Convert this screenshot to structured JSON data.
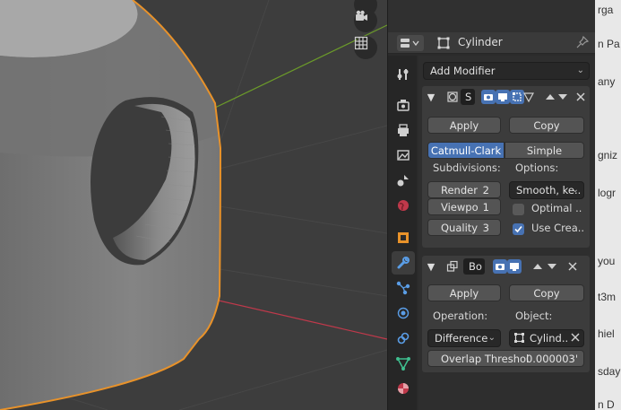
{
  "header": {
    "object_name": "Cylinder"
  },
  "content": {
    "add_modifier_label": "Add Modifier"
  },
  "subsurf": {
    "name": "S",
    "apply_label": "Apply",
    "copy_label": "Copy",
    "algorithm": {
      "catmull_label": "Catmull-Clark",
      "simple_label": "Simple",
      "selected": "Catmull-Clark"
    },
    "subdivisions_label": "Subdivisions:",
    "options_label": "Options:",
    "render_label": "Render",
    "render_value": "2",
    "viewport_label": "Viewpo",
    "viewport_value": "1",
    "quality_label": "Quality",
    "quality_value": "3",
    "uv_smooth_value": "Smooth, ke..",
    "optimal_label": "Optimal ..",
    "optimal_checked": false,
    "use_crease_label": "Use Crea..",
    "use_crease_checked": true
  },
  "boolean": {
    "name": "Bo",
    "apply_label": "Apply",
    "copy_label": "Copy",
    "operation_label": "Operation:",
    "object_label": "Object:",
    "operation_value": "Difference",
    "object_value": "Cylind..",
    "overlap_label": "Overlap Threshol",
    "overlap_value": "0.000003'"
  },
  "background_text": [
    "rga",
    "n Pa",
    "any",
    "gniz",
    "logr",
    "you",
    "t3m",
    "hiel",
    "sday",
    "n D"
  ],
  "colors": {
    "accent_blue": "#4772b3",
    "selection_orange": "#e8922a",
    "axis_red": "#c0394b",
    "axis_green": "#6b9a2a",
    "panel_bg": "#3c3c3c"
  },
  "icons": {
    "viewport_camera": "camera-icon",
    "viewport_grid": "grid-icon",
    "tabs": [
      "tool-icon",
      "render-icon",
      "output-icon",
      "view-layer-icon",
      "scene-icon",
      "world-icon",
      "object-icon",
      "modifier-icon",
      "particles-icon",
      "physics-icon",
      "constraints-icon",
      "data-icon",
      "material-icon"
    ]
  }
}
